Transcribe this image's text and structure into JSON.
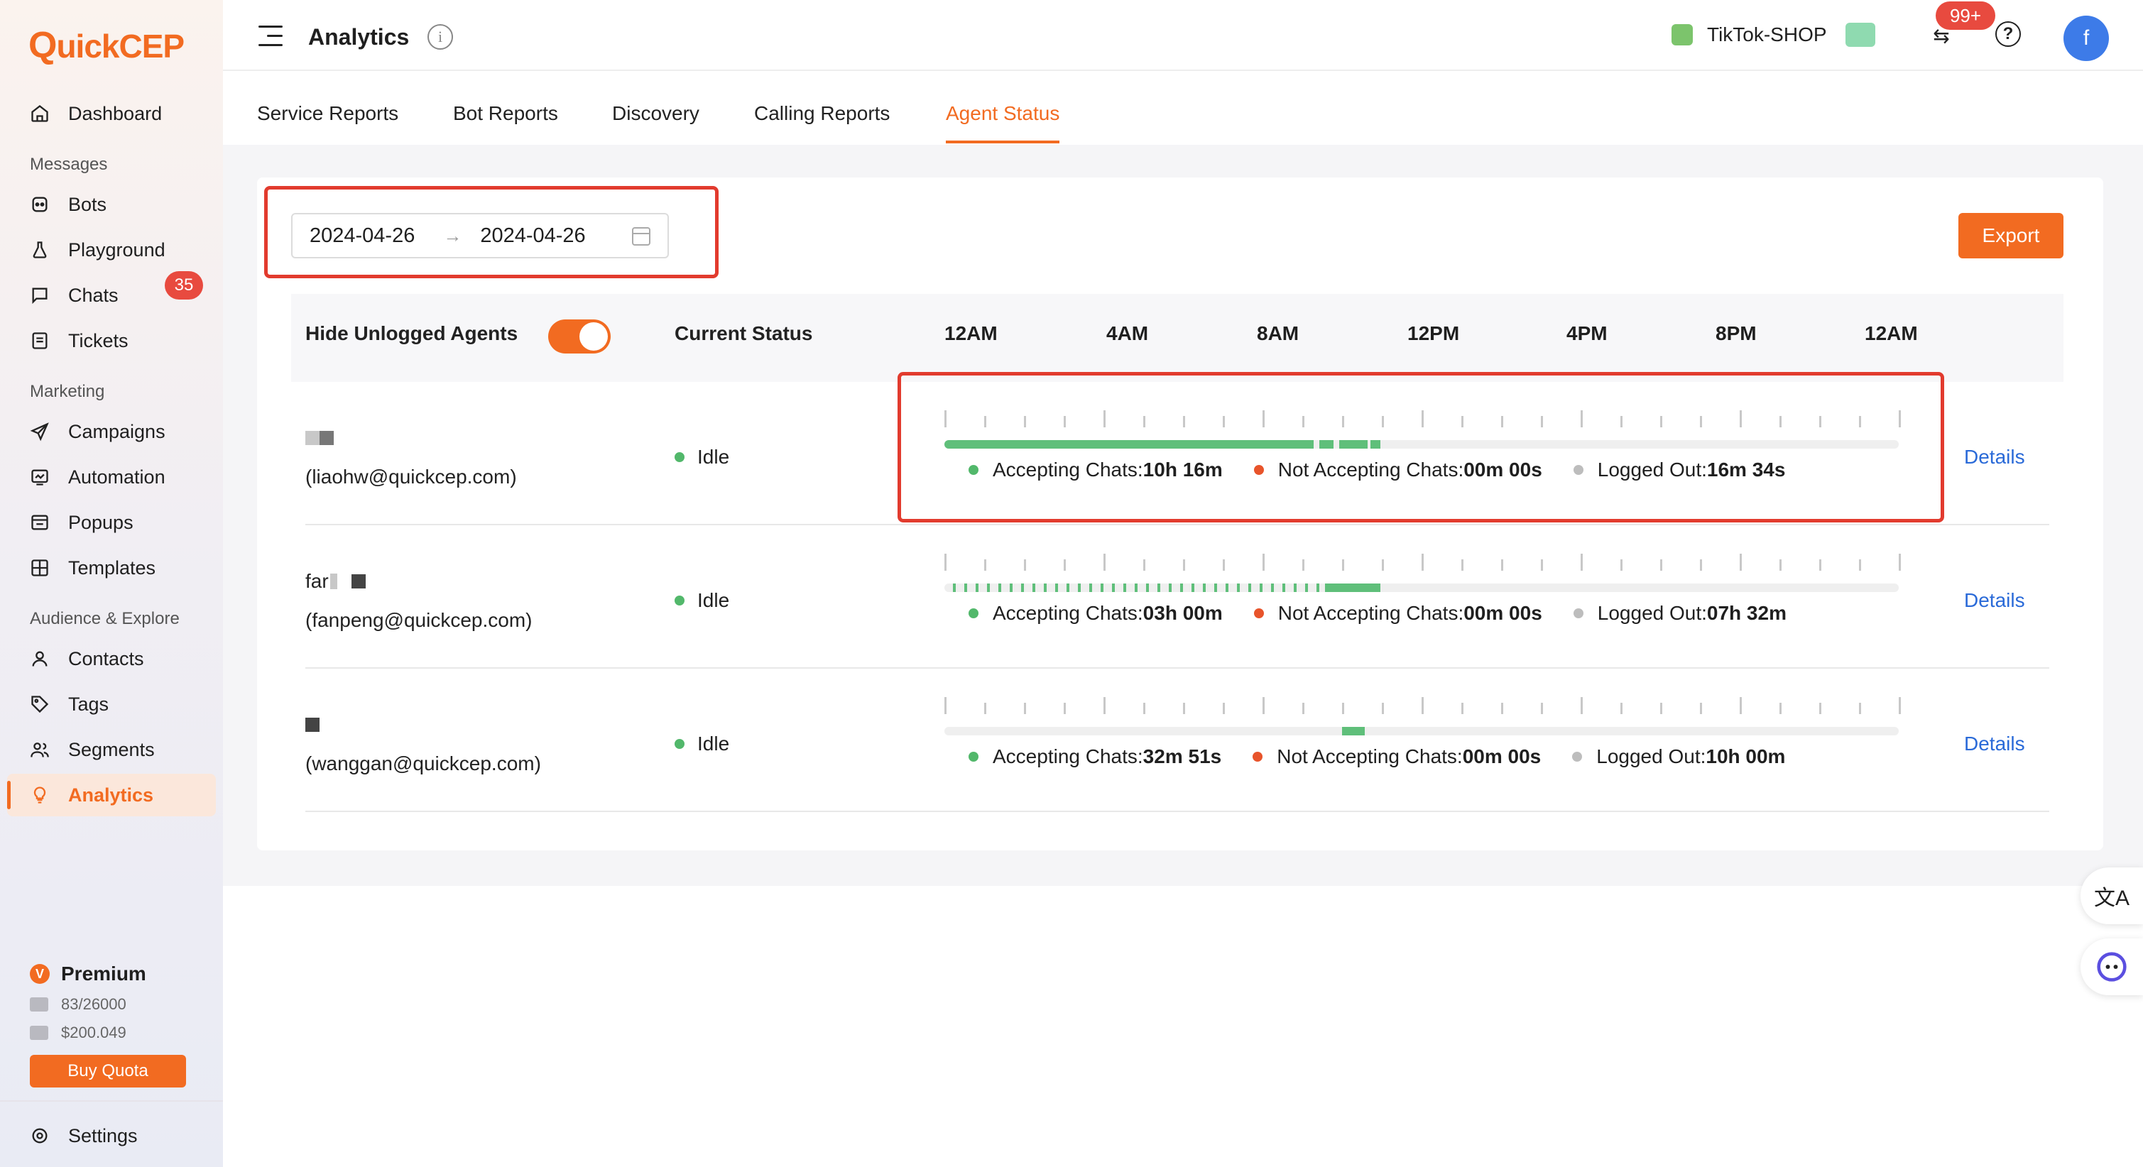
{
  "brand": {
    "logo_q": "Q",
    "logo_rest": "uick",
    "logo_cep": "CEP"
  },
  "sidebar": {
    "dashboard": "Dashboard",
    "section_messages": "Messages",
    "bots": "Bots",
    "playground": "Playground",
    "chats": "Chats",
    "chats_badge": "35",
    "tickets": "Tickets",
    "section_marketing": "Marketing",
    "campaigns": "Campaigns",
    "automation": "Automation",
    "popups": "Popups",
    "templates": "Templates",
    "section_audience": "Audience & Explore",
    "contacts": "Contacts",
    "tags": "Tags",
    "segments": "Segments",
    "analytics": "Analytics",
    "premium": "Premium",
    "premium_icon": "V",
    "quota_messages": "83/26000",
    "quota_balance": "$200.049",
    "buy_quota": "Buy Quota",
    "settings": "Settings"
  },
  "header": {
    "title": "Analytics",
    "shop_name": "TikTok-SHOP",
    "notifications_badge": "99+",
    "avatar_letter": "f"
  },
  "tabs": [
    "Service Reports",
    "Bot Reports",
    "Discovery",
    "Calling Reports",
    "Agent Status"
  ],
  "toolbar": {
    "date_start": "2024-04-26",
    "date_end": "2024-04-26",
    "export": "Export"
  },
  "table": {
    "hide_unlogged": "Hide Unlogged Agents",
    "hide_unlogged_on": true,
    "current_status": "Current Status",
    "hours": [
      "12AM",
      "4AM",
      "8AM",
      "12PM",
      "4PM",
      "8PM",
      "12AM"
    ],
    "accepting_label": "Accepting Chats:",
    "not_accepting_label": "Not Accepting Chats:",
    "logged_out_label": "Logged Out:",
    "details": "Details",
    "rows": [
      {
        "name": "",
        "email": "(liaohw@quickcep.com)",
        "status": "Idle",
        "accepting": "10h 16m",
        "not_accepting": "00m 00s",
        "logged_out": "16m 34s",
        "activity_segments_hours": [
          [
            0,
            11.2
          ],
          [
            11.3,
            11.6
          ],
          [
            11.7,
            12.5
          ],
          [
            12.6,
            12.9
          ]
        ]
      },
      {
        "name": "far",
        "email": "(fanpeng@quickcep.com)",
        "status": "Idle",
        "accepting": "03h 00m",
        "not_accepting": "00m 00s",
        "logged_out": "07h 32m",
        "activity_segments_hours": "intermittent 0–12.9"
      },
      {
        "name": "",
        "email": "(wanggan@quickcep.com)",
        "status": "Idle",
        "accepting": "32m 51s",
        "not_accepting": "00m 00s",
        "logged_out": "10h 00m",
        "activity_segments_hours": [
          [
            12.2,
            12.9
          ]
        ]
      }
    ]
  },
  "colors": {
    "accent": "#f26b21",
    "accepting": "#52b86b",
    "not_accepting": "#e8542b",
    "logged_out": "#bdbdbd",
    "link": "#2a6ad8",
    "highlight": "#e23b2e"
  },
  "icons": {
    "dashboard": "home-icon",
    "bots": "bot-icon",
    "playground": "flask-icon",
    "chats": "chat-icon",
    "tickets": "ticket-icon",
    "campaigns": "send-icon",
    "automation": "automation-icon",
    "popups": "popup-icon",
    "templates": "grid-icon",
    "contacts": "person-icon",
    "tags": "tag-icon",
    "segments": "people-icon",
    "analytics": "bulb-icon",
    "settings": "gear-icon"
  }
}
